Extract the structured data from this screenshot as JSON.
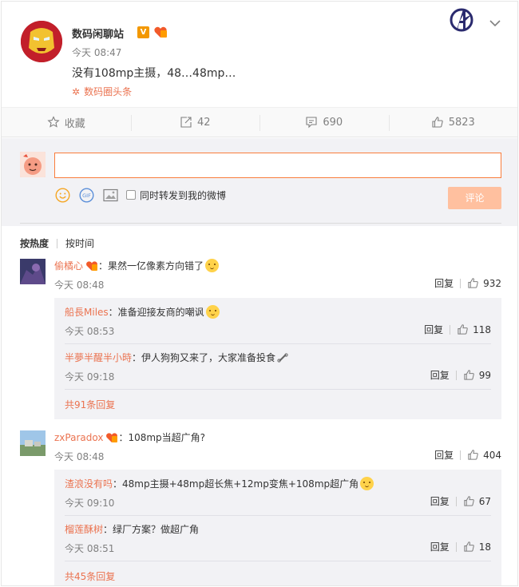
{
  "post": {
    "author": "数码闲聊站",
    "verified_badge": "V",
    "time": "今天 08:47",
    "text": "没有108mp主摄，48…48mp…",
    "topic": "数码圈头条"
  },
  "actions": {
    "favorite": "收藏",
    "repost": "42",
    "comment": "690",
    "like": "5823"
  },
  "compose": {
    "input_value": "",
    "sync_label": "同时转发到我的微博",
    "submit": "评论"
  },
  "sort": {
    "hot": "按热度",
    "time": "按时间"
  },
  "comments": [
    {
      "user": "偷橘心",
      "text": "：果然一亿像素方向错了",
      "time": "今天 08:48",
      "reply": "回复",
      "likes": "932",
      "replies": [
        {
          "user": "船長Miles",
          "text": "：准备迎接友商的嘲讽",
          "time": "今天 08:53",
          "reply": "回复",
          "likes": "118"
        },
        {
          "user": "半夢半醒半小時",
          "text": "：伊人狗狗又来了，大家准备投食",
          "time": "今天 09:18",
          "reply": "回复",
          "likes": "99"
        }
      ],
      "more": "共91条回复"
    },
    {
      "user": "zxParadox",
      "text": "：108mp当超广角?",
      "time": "今天 08:48",
      "reply": "回复",
      "likes": "404",
      "replies": [
        {
          "user": "渣浪没有吗",
          "text": "：48mp主摄+48mp超长焦+12mp变焦+108mp超广角",
          "time": "今天 09:10",
          "reply": "回复",
          "likes": "67"
        },
        {
          "user": "榴莲酥树",
          "text": "：绿厂方案？做超广角",
          "time": "今天 08:51",
          "reply": "回复",
          "likes": "18"
        }
      ],
      "more": "共45条回复"
    }
  ],
  "colors": {
    "accent": "#eb7350",
    "input_border": "#fa7d3c",
    "submit_bg": "#ffc09f",
    "panel_bg": "#f2f2f5"
  }
}
